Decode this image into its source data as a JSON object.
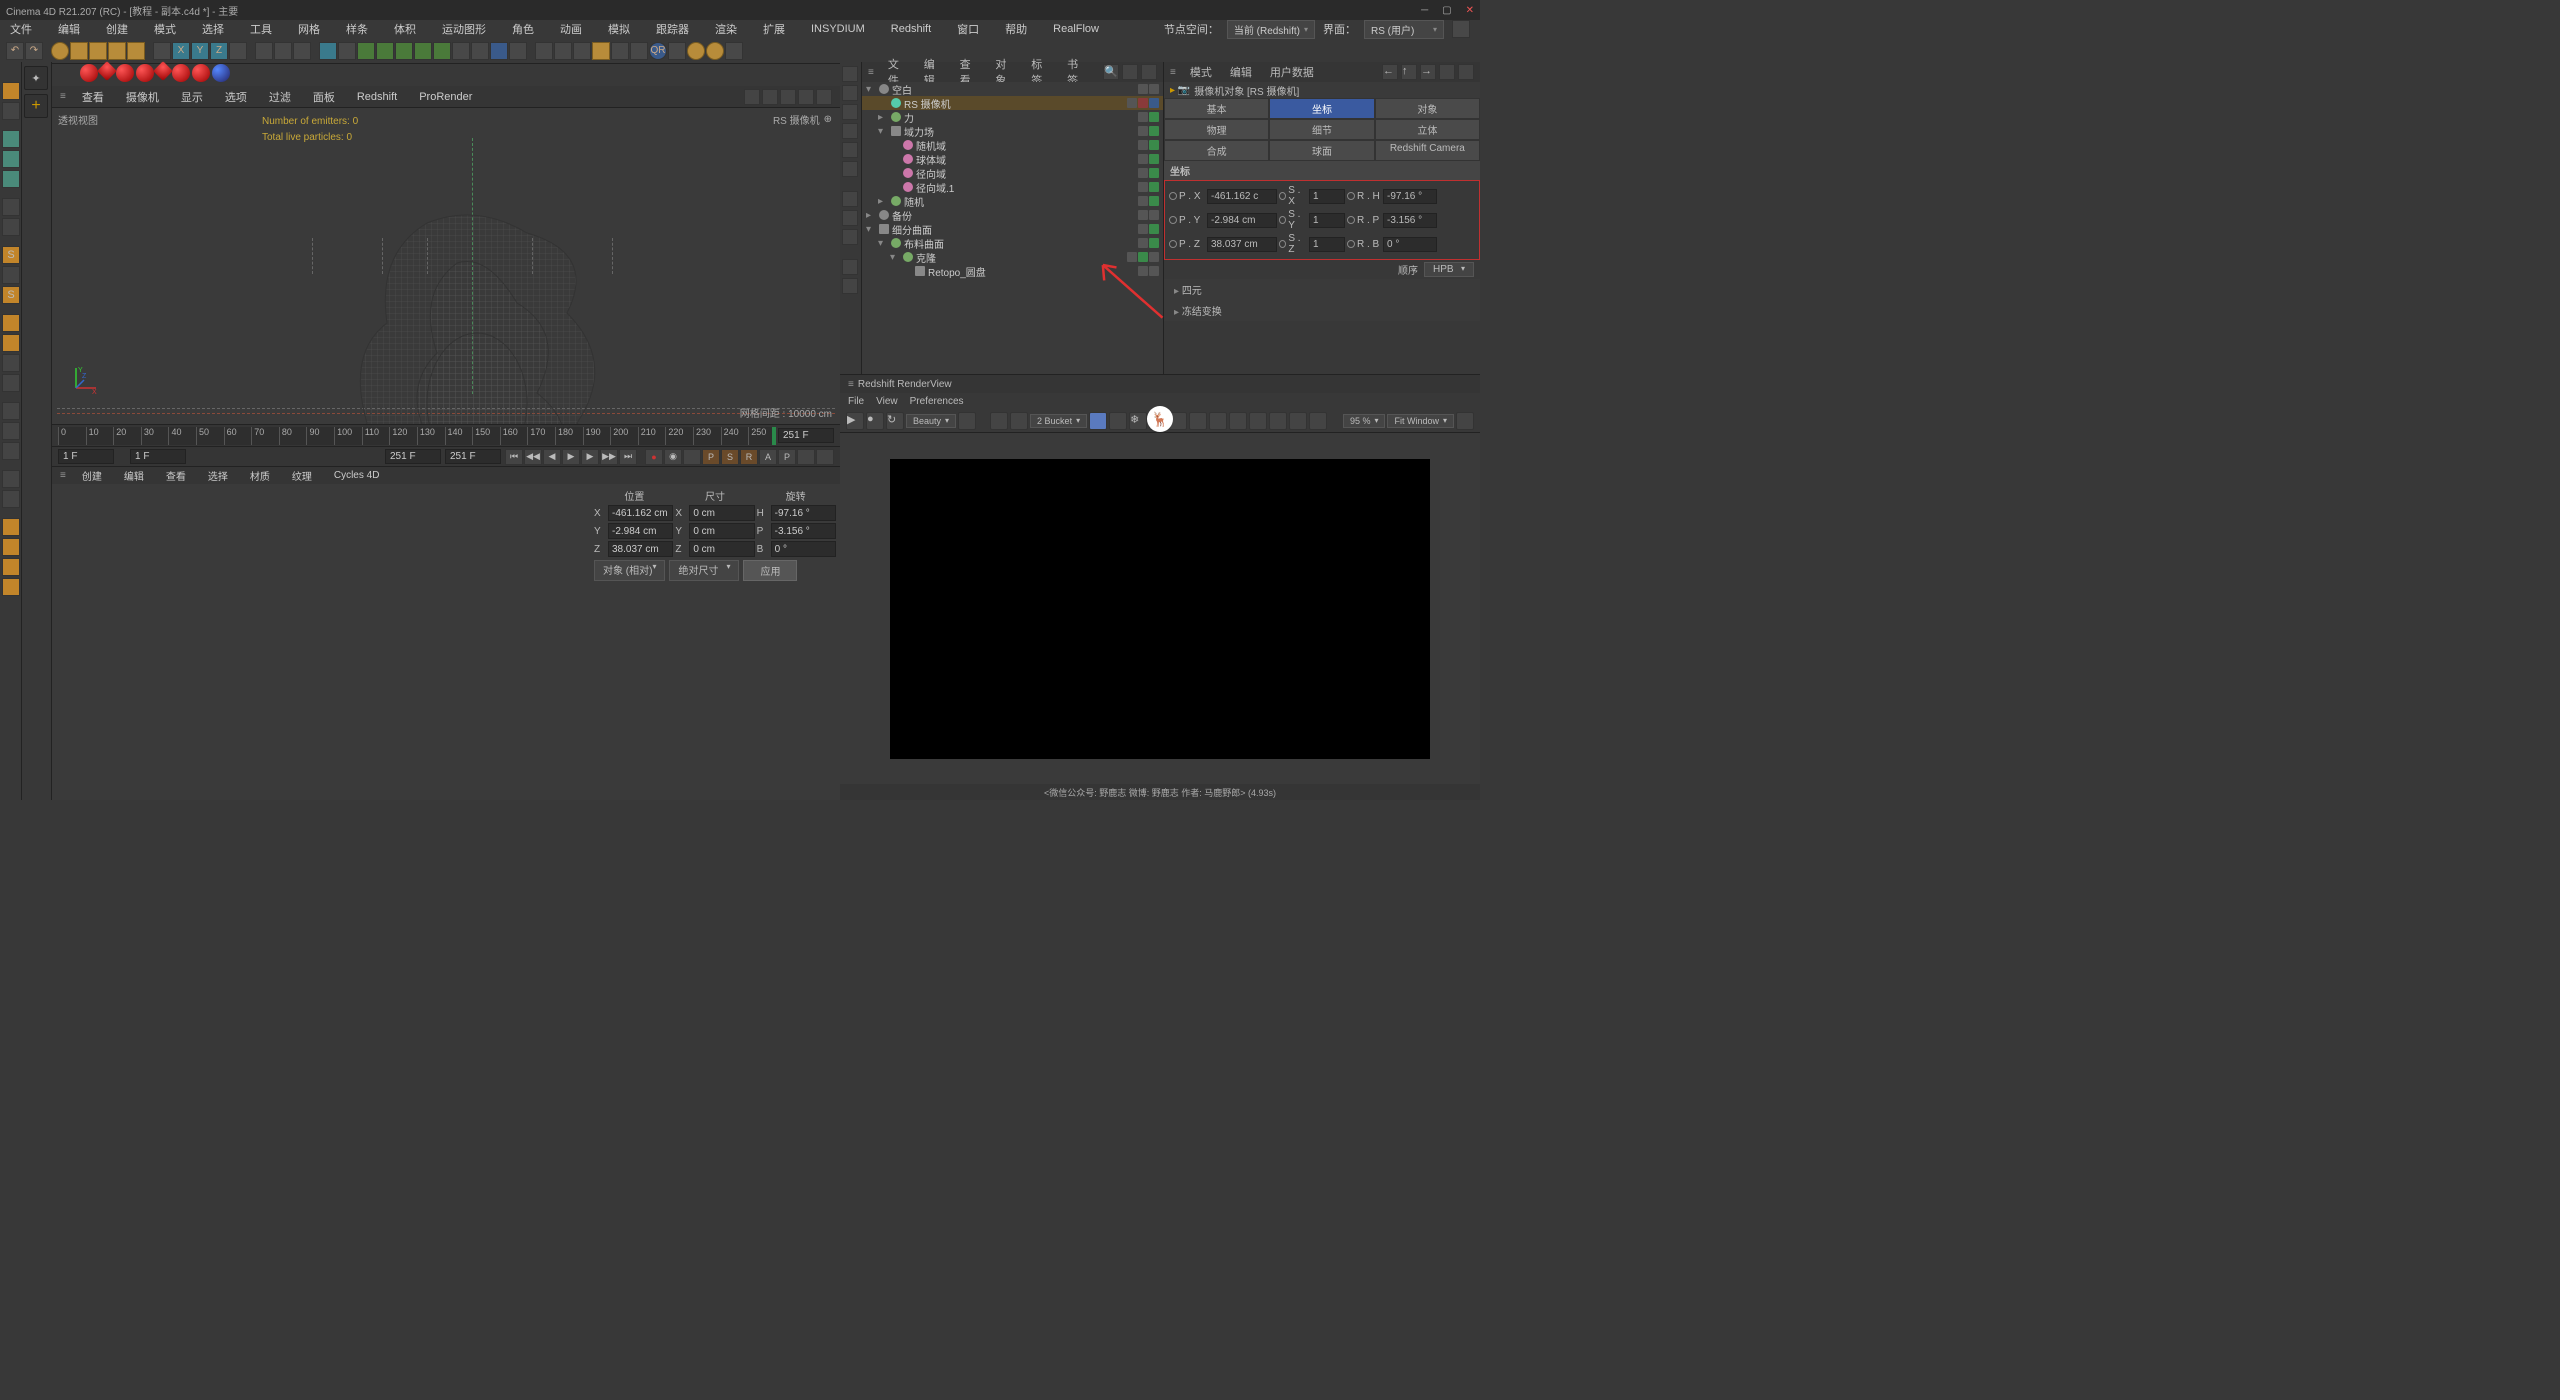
{
  "title": "Cinema 4D R21.207 (RC) - [教程 - 副本.c4d *] - 主要",
  "menu": [
    "文件",
    "编辑",
    "创建",
    "模式",
    "选择",
    "工具",
    "网格",
    "样条",
    "体积",
    "运动图形",
    "角色",
    "动画",
    "模拟",
    "跟踪器",
    "渲染",
    "扩展",
    "INSYDIUM",
    "Redshift",
    "窗口",
    "帮助",
    "RealFlow"
  ],
  "menuRight": {
    "label1": "节点空间：",
    "drop1": "当前 (Redshift)",
    "label2": "界面：",
    "drop2": "RS (用户)"
  },
  "viewMenu": [
    "查看",
    "摄像机",
    "显示",
    "选项",
    "过滤",
    "面板",
    "Redshift",
    "ProRender"
  ],
  "viewport": {
    "label": "透视视图",
    "camera": "RS 摄像机",
    "stats1": "Number of emitters: 0",
    "stats2": "Total live particles: 0",
    "gridinfo": "网格间距 : 10000 cm"
  },
  "timeline": {
    "marks": [
      "0",
      "10",
      "20",
      "30",
      "40",
      "50",
      "60",
      "70",
      "80",
      "90",
      "100",
      "110",
      "120",
      "130",
      "140",
      "150",
      "160",
      "170",
      "180",
      "190",
      "200",
      "210",
      "220",
      "230",
      "240",
      "250"
    ],
    "cur": "251 F",
    "startF": "1 F",
    "startV": "1 F",
    "endF": "251 F",
    "endV": "251 F"
  },
  "matMenu": [
    "创建",
    "编辑",
    "查看",
    "选择",
    "材质",
    "纹理",
    "Cycles 4D"
  ],
  "coordPanel": {
    "hdr": [
      "位置",
      "尺寸",
      "旋转"
    ],
    "rows": [
      {
        "a": "X",
        "v1": "-461.162 cm",
        "b": "X",
        "v2": "0 cm",
        "c": "H",
        "v3": "-97.16 °"
      },
      {
        "a": "Y",
        "v1": "-2.984 cm",
        "b": "Y",
        "v2": "0 cm",
        "c": "P",
        "v3": "-3.156 °"
      },
      {
        "a": "Z",
        "v1": "38.037 cm",
        "b": "Z",
        "v2": "0 cm",
        "c": "B",
        "v3": "0 °"
      }
    ],
    "d1": "对象 (相对)",
    "d2": "绝对尺寸",
    "apply": "应用"
  },
  "objMgr": {
    "menu": [
      "文件",
      "编辑",
      "查看",
      "对象",
      "标签",
      "书签"
    ],
    "tree": [
      {
        "ind": 0,
        "exp": "▾",
        "icon": "nil",
        "name": "空白",
        "sel": false,
        "tags": [
          "",
          ""
        ]
      },
      {
        "ind": 1,
        "exp": "",
        "icon": "cam",
        "name": "RS 摄像机",
        "sel": true,
        "tags": [
          "",
          "r",
          "b"
        ]
      },
      {
        "ind": 1,
        "exp": "▸",
        "icon": "field",
        "name": "力",
        "sel": false,
        "tags": [
          "",
          "g"
        ]
      },
      {
        "ind": 1,
        "exp": "▾",
        "icon": "cube",
        "name": "域力场",
        "sel": false,
        "tags": [
          "",
          "g"
        ]
      },
      {
        "ind": 2,
        "exp": "",
        "icon": "pink",
        "name": "随机域",
        "sel": false,
        "tags": [
          "",
          "g"
        ]
      },
      {
        "ind": 2,
        "exp": "",
        "icon": "pink",
        "name": "球体域",
        "sel": false,
        "tags": [
          "",
          "g"
        ]
      },
      {
        "ind": 2,
        "exp": "",
        "icon": "pink",
        "name": "径向域",
        "sel": false,
        "tags": [
          "",
          "g"
        ]
      },
      {
        "ind": 2,
        "exp": "",
        "icon": "pink",
        "name": "径向域.1",
        "sel": false,
        "tags": [
          "",
          "g"
        ]
      },
      {
        "ind": 1,
        "exp": "▸",
        "icon": "field",
        "name": "随机",
        "sel": false,
        "tags": [
          "",
          "g"
        ]
      },
      {
        "ind": 0,
        "exp": "▸",
        "icon": "nil",
        "name": "备份",
        "sel": false,
        "tags": [
          "",
          ""
        ]
      },
      {
        "ind": 0,
        "exp": "▾",
        "icon": "cube",
        "name": "细分曲面",
        "sel": false,
        "tags": [
          "",
          "g"
        ]
      },
      {
        "ind": 1,
        "exp": "▾",
        "icon": "field",
        "name": "布料曲面",
        "sel": false,
        "tags": [
          "",
          "g"
        ]
      },
      {
        "ind": 2,
        "exp": "▾",
        "icon": "field",
        "name": "克隆",
        "sel": false,
        "tags": [
          "",
          "g",
          ""
        ]
      },
      {
        "ind": 3,
        "exp": "",
        "icon": "cube",
        "name": "Retopo_圆盘",
        "sel": false,
        "tags": [
          "",
          ""
        ]
      }
    ]
  },
  "attrMgr": {
    "menu": [
      "模式",
      "编辑",
      "用户数据"
    ],
    "objTitle": "摄像机对象 [RS 摄像机]",
    "tabs": [
      [
        "基本",
        "坐标",
        "对象"
      ],
      [
        "物理",
        "细节",
        "立体"
      ],
      [
        "合成",
        "球面",
        "Redshift Camera"
      ]
    ],
    "activeTab": "坐标",
    "section": "坐标",
    "rows": [
      {
        "pl": "P . X",
        "pv": "-461.162 c",
        "sl": "S . X",
        "sv": "1",
        "rl": "R . H",
        "rv": "-97.16 °"
      },
      {
        "pl": "P . Y",
        "pv": "-2.984 cm",
        "sl": "S . Y",
        "sv": "1",
        "rl": "R . P",
        "rv": "-3.156 °"
      },
      {
        "pl": "P . Z",
        "pv": "38.037 cm",
        "sl": "S . Z",
        "sv": "1",
        "rl": "R . B",
        "rv": "0 °"
      }
    ],
    "orderL": "顺序",
    "orderV": "HPB",
    "exp1": "四元",
    "exp2": "冻结变换"
  },
  "rsView": {
    "title": "Redshift RenderView",
    "menu": [
      "File",
      "View",
      "Preferences"
    ],
    "beauty": "Beauty",
    "bucket": "2 Bucket",
    "pct": "95 %",
    "fit": "Fit Window",
    "footer": "<微信公众号: 野鹿志   微博: 野鹿志   作者: 马鹿野郎>  (4.93s)"
  }
}
